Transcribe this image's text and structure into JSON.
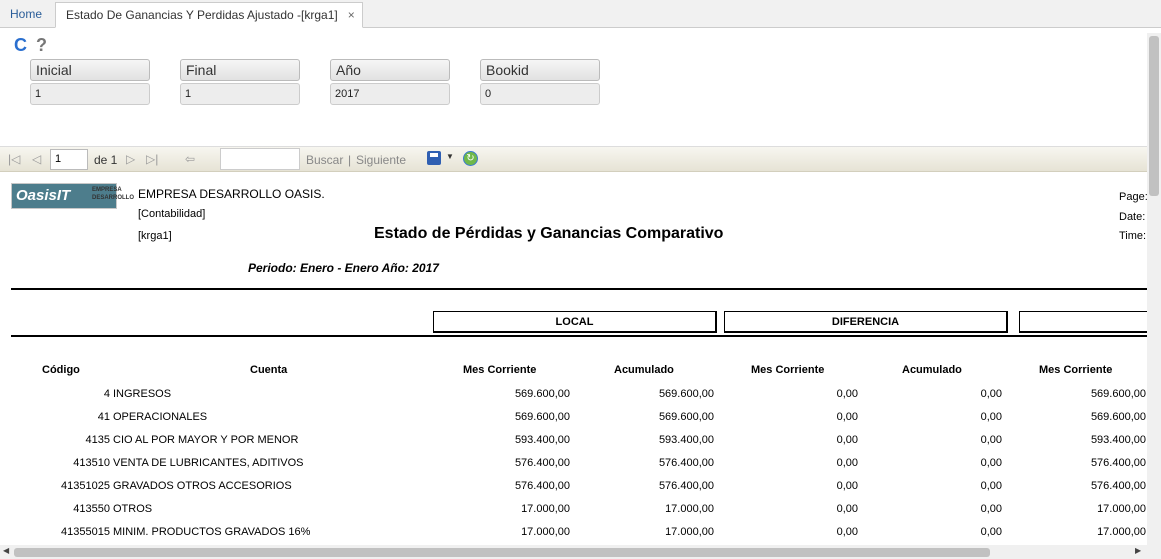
{
  "tabs": {
    "home": "Home",
    "active": "Estado De Ganancias Y Perdidas Ajustado -[krga1]",
    "close": "×"
  },
  "icons": {
    "refresh": "C",
    "help": "?"
  },
  "params": [
    {
      "label": "Inicial",
      "value": "1"
    },
    {
      "label": "Final",
      "value": "1"
    },
    {
      "label": "Año",
      "value": "2017"
    },
    {
      "label": "Bookid",
      "value": "0"
    }
  ],
  "viewer": {
    "page_value": "1",
    "page_of": "de 1",
    "search_label": "Buscar",
    "separator": "|",
    "next_label": "Siguiente"
  },
  "report": {
    "logo_word": "OasisIT",
    "logo_tag": "EMPRESA DESARROLLO",
    "company": "EMPRESA DESARROLLO OASIS.",
    "department": "[Contabilidad]",
    "code": "[krga1]",
    "title": "Estado de Pérdidas y Ganancias Comparativo",
    "page_label": "Page:",
    "date_label": "Date:",
    "time_label": "Time:",
    "period": "Periodo:  Enero - Enero   Año: 2017",
    "groups": [
      "LOCAL",
      "DIFERENCIA",
      ""
    ],
    "headers": [
      "Código",
      "Cuenta",
      "Mes Corriente",
      "Acumulado",
      "Mes Corriente",
      "Acumulado",
      "Mes Corriente"
    ],
    "rows": [
      {
        "code": "4",
        "account": "INGRESOS",
        "v1": "569.600,00",
        "v2": "569.600,00",
        "v3": "0,00",
        "v4": "0,00",
        "v5": "569.600,00"
      },
      {
        "code": "41",
        "account": "OPERACIONALES",
        "v1": "569.600,00",
        "v2": "569.600,00",
        "v3": "0,00",
        "v4": "0,00",
        "v5": "569.600,00"
      },
      {
        "code": "4135",
        "account": "CIO AL POR MAYOR Y POR MENOR",
        "v1": "593.400,00",
        "v2": "593.400,00",
        "v3": "0,00",
        "v4": "0,00",
        "v5": "593.400,00"
      },
      {
        "code": "413510",
        "account": "VENTA DE LUBRICANTES, ADITIVOS",
        "v1": "576.400,00",
        "v2": "576.400,00",
        "v3": "0,00",
        "v4": "0,00",
        "v5": "576.400,00"
      },
      {
        "code": "41351025",
        "account": "GRAVADOS OTROS ACCESORIOS",
        "v1": "576.400,00",
        "v2": "576.400,00",
        "v3": "0,00",
        "v4": "0,00",
        "v5": "576.400,00"
      },
      {
        "code": "413550",
        "account": "OTROS",
        "v1": "17.000,00",
        "v2": "17.000,00",
        "v3": "0,00",
        "v4": "0,00",
        "v5": "17.000,00"
      },
      {
        "code": "41355015",
        "account": "MINIM. PRODUCTOS GRAVADOS 16%",
        "v1": "17.000,00",
        "v2": "17.000,00",
        "v3": "0,00",
        "v4": "0,00",
        "v5": "17.000,00"
      }
    ]
  },
  "colors": {
    "link_blue": "#2a5d99",
    "refresh_blue": "#2a6fcf"
  }
}
